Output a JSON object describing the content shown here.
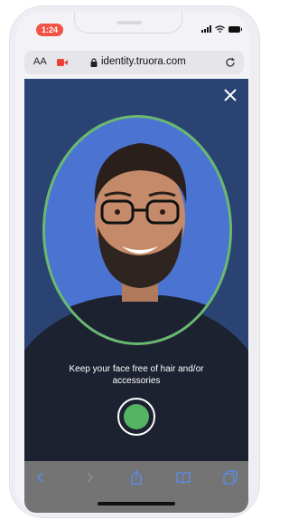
{
  "status_bar": {
    "time": "1:24"
  },
  "browser": {
    "text_size_label": "AA",
    "url": "identity.truora.com",
    "icons": [
      "camera-recording-icon",
      "lock-icon",
      "reload-icon"
    ]
  },
  "capture": {
    "instruction": "Keep your face free of hair and/or accessories",
    "frame_color": "#69b96f",
    "button_color": "#55b364",
    "background_color": "#2a4372"
  },
  "toolbar": {
    "icons": [
      "back-icon",
      "forward-icon",
      "share-icon",
      "bookmarks-icon",
      "tabs-icon"
    ]
  },
  "colors": {
    "recording_badge": "#f15246",
    "oval_fill": "#4b73d1"
  }
}
